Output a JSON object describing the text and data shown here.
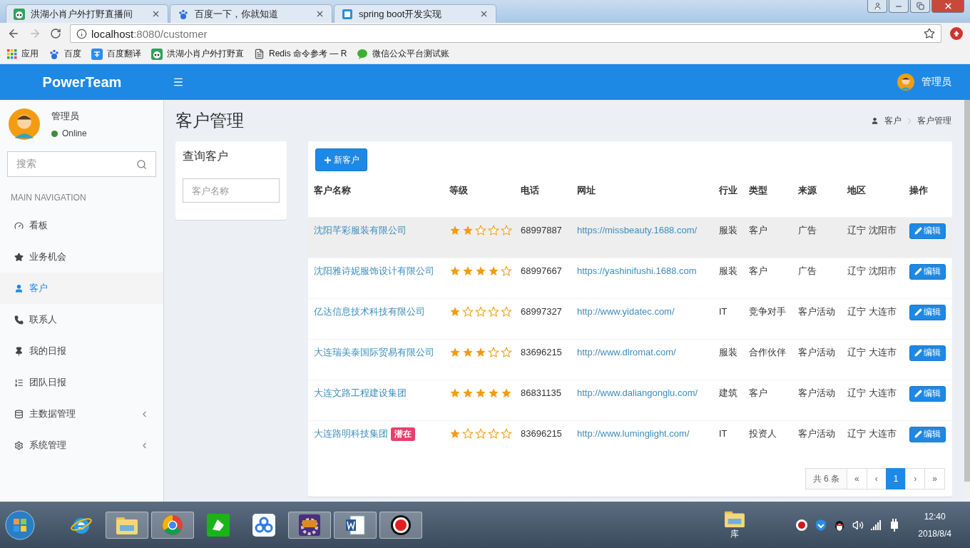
{
  "browser": {
    "tabs": [
      {
        "title": "洪湖小肖户外打野直播间"
      },
      {
        "title": "百度一下，你就知道"
      },
      {
        "title": "spring boot开发实现"
      }
    ],
    "address": {
      "host": "localhost",
      "path": ":8080/customer"
    },
    "bookmarks": [
      {
        "label": "应用"
      },
      {
        "label": "百度"
      },
      {
        "label": "百度翻译"
      },
      {
        "label": "洪湖小肖户外打野直"
      },
      {
        "label": "Redis 命令参考 — R"
      },
      {
        "label": "微信公众平台测试账"
      }
    ]
  },
  "header": {
    "brand": "PowerTeam",
    "user": "管理员"
  },
  "sidebar": {
    "user": "管理员",
    "status": "Online",
    "search_placeholder": "搜索",
    "section": "MAIN NAVIGATION",
    "items": [
      {
        "label": "看板",
        "selected": false
      },
      {
        "label": "业务机会",
        "selected": false
      },
      {
        "label": "客户",
        "selected": true
      },
      {
        "label": "联系人",
        "selected": false
      },
      {
        "label": "我的日报",
        "selected": false
      },
      {
        "label": "团队日报",
        "selected": false
      },
      {
        "label": "主数据管理",
        "selected": false,
        "expanded": false
      },
      {
        "label": "系统管理",
        "selected": false,
        "expanded": false
      }
    ]
  },
  "page": {
    "title": "客户管理",
    "breadcrumb": [
      "客户",
      "客户管理"
    ]
  },
  "query": {
    "title": "查询客户",
    "placeholder": "客户名称"
  },
  "new_button": "新客户",
  "table": {
    "columns": [
      "客户名称",
      "等级",
      "电话",
      "网址",
      "行业",
      "类型",
      "来源",
      "地区",
      "操作"
    ],
    "rows": [
      {
        "name": "沈阳芊彩服装有限公司",
        "stars": 2,
        "phone": "68997887",
        "url": "https://missbeauty.1688.com/",
        "industry": "服装",
        "type": "客户",
        "source": "广告",
        "region": "辽宁 沈阳市",
        "action": "编辑",
        "highlighted": true
      },
      {
        "name": "沈阳雅诗妮服饰设计有限公司",
        "stars": 4,
        "phone": "68997667",
        "url": "https://yashinifushi.1688.com",
        "industry": "服装",
        "type": "客户",
        "source": "广告",
        "region": "辽宁 沈阳市",
        "action": "编辑",
        "highlighted": false
      },
      {
        "name": "亿达信息技术科技有限公司",
        "stars": 1,
        "phone": "68997327",
        "url": "http://www.yidatec.com/",
        "industry": "IT",
        "type": "竞争对手",
        "source": "客户活动",
        "region": "辽宁 大连市",
        "action": "编辑",
        "highlighted": false
      },
      {
        "name": "大连瑞美泰国际贸易有限公司",
        "stars": 3,
        "phone": "83696215",
        "url": "http://www.dlromat.com/",
        "industry": "服装",
        "type": "合作伙伴",
        "source": "客户活动",
        "region": "辽宁 大连市",
        "action": "编辑",
        "highlighted": false
      },
      {
        "name": "大连文路工程建设集团",
        "stars": 5,
        "phone": "86831135",
        "url": "http://www.daliangonglu.com/",
        "industry": "建筑",
        "type": "客户",
        "source": "客户活动",
        "region": "辽宁 大连市",
        "action": "编辑",
        "highlighted": false
      },
      {
        "name": "大连路明科技集团",
        "tag": "潜在",
        "stars": 1,
        "phone": "83696215",
        "url": "http://www.luminglight.com/",
        "industry": "IT",
        "type": "投资人",
        "source": "客户活动",
        "region": "辽宁 大连市",
        "action": "编辑",
        "highlighted": false
      }
    ]
  },
  "pagination": {
    "total": "共 6 条",
    "pages": [
      {
        "label": "«",
        "selected": false
      },
      {
        "label": "‹",
        "selected": false
      },
      {
        "label": "1",
        "selected": true
      },
      {
        "label": "›",
        "selected": false
      },
      {
        "label": "»",
        "selected": false
      }
    ]
  },
  "taskbar": {
    "apps": [
      {
        "open": false
      },
      {
        "open": true
      },
      {
        "open": true
      },
      {
        "open": false
      },
      {
        "open": false
      },
      {
        "open": true
      },
      {
        "open": true
      },
      {
        "open": true
      }
    ],
    "library": "库",
    "time": "12:40",
    "date": "2018/8/4"
  }
}
